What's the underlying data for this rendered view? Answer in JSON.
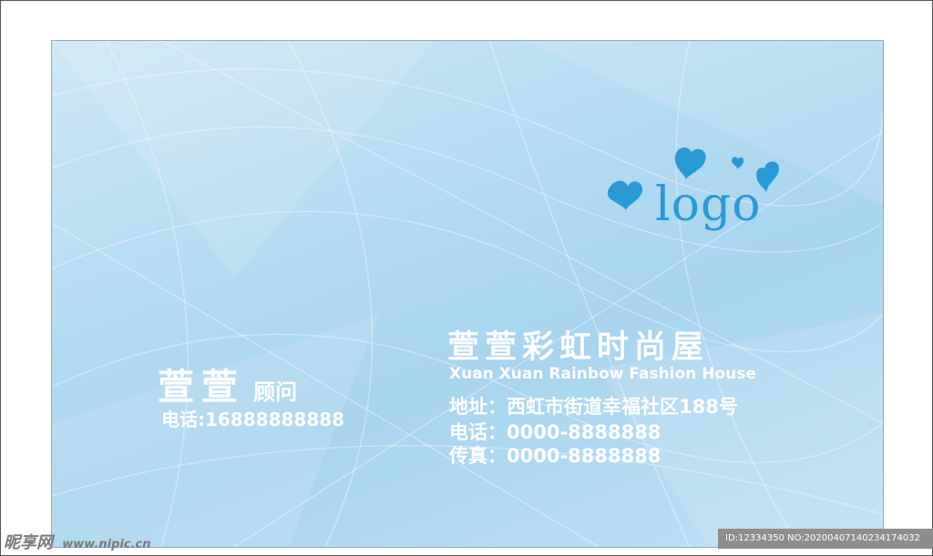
{
  "logo": {
    "text": "logo",
    "color": "#2a9ad6"
  },
  "company": {
    "name_cn": "萱萱彩虹时尚屋",
    "name_en": "Xuan Xuan Rainbow Fashion House",
    "address": "地址：西虹市街道幸福社区188号",
    "phone": "电话：0000-8888888",
    "fax": "传真：0000-8888888"
  },
  "person": {
    "name": "萱萱",
    "title": "顾问",
    "phone": "电话:16888888888"
  },
  "watermark": {
    "brand": "昵享网",
    "site": "www.nipic.cn",
    "id_text": "ID:12334350 NO:20200407140234174032"
  }
}
